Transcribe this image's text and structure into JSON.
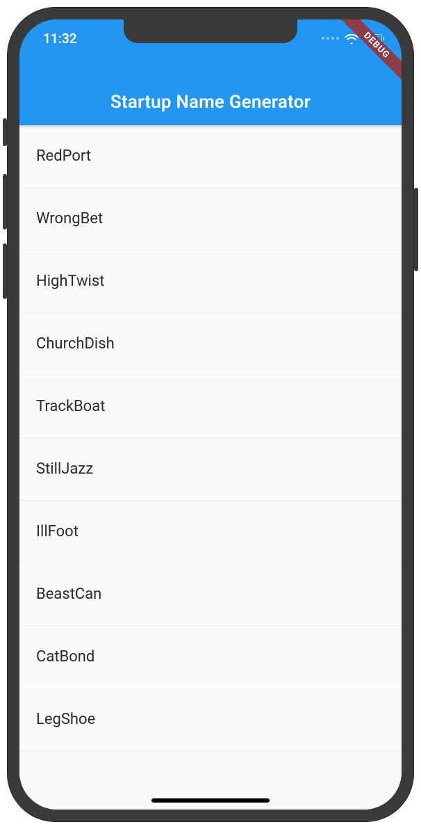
{
  "statusbar": {
    "time": "11:32"
  },
  "appbar": {
    "title": "Startup Name Generator"
  },
  "debug_banner": "DEBUG",
  "list": {
    "items": [
      "RedPort",
      "WrongBet",
      "HighTwist",
      "ChurchDish",
      "TrackBoat",
      "StillJazz",
      "IllFoot",
      "BeastCan",
      "CatBond",
      "LegShoe"
    ]
  }
}
